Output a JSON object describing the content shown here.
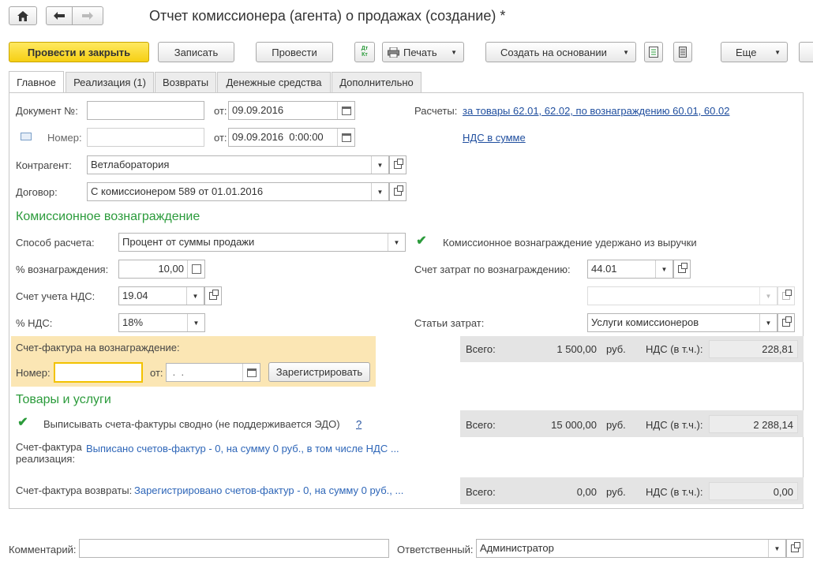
{
  "window": {
    "title": "Отчет комиссионера (агента) о продажах (создание) *"
  },
  "toolbar": {
    "post_and_close": "Провести и закрыть",
    "save": "Записать",
    "post": "Провести",
    "print": "Печать",
    "create_based_on": "Создать на основании",
    "more": "Еще",
    "dtkt_icon": "Дт Кт"
  },
  "tabs": [
    {
      "label": "Главное"
    },
    {
      "label": "Реализация (1)"
    },
    {
      "label": "Возвраты"
    },
    {
      "label": "Денежные средства"
    },
    {
      "label": "Дополнительно"
    }
  ],
  "main": {
    "doc_no_label": "Документ №:",
    "doc_no_value": "",
    "from_label": "от:",
    "doc_date": "09.09.2016",
    "number_label": "Номер:",
    "number_value": "",
    "number_datetime": "09.09.2016  0:00:00",
    "calc_label": "Расчеты:",
    "calc_link": "за товары 62.01, 62.02, по вознаграждению 60.01, 60.02",
    "vat_link": "НДС в сумме",
    "contractor_label": "Контрагент:",
    "contractor_value": "Ветлаборатория",
    "contract_label": "Договор:",
    "contract_value": "С комиссионером 589 от 01.01.2016"
  },
  "commission": {
    "section_title": "Комиссионное вознаграждение",
    "method_label": "Способ расчета:",
    "method_value": "Процент от суммы продажи",
    "withheld_label": "Комиссионное вознаграждение удержано из выручки",
    "withheld_checked": true,
    "percent_label": "% вознаграждения:",
    "percent_value": "10,00",
    "cost_account_label": "Счет затрат по вознаграждению:",
    "cost_account_value": "44.01",
    "vat_account_label": "Счет учета НДС:",
    "vat_account_value": "19.04",
    "extra_value": "",
    "vat_rate_label": "% НДС:",
    "vat_rate_value": "18%",
    "cost_items_label": "Статьи затрат:",
    "cost_items_value": "Услуги комиссионеров",
    "invoice_title": "Счет-фактура на вознаграждение:",
    "invoice_number_label": "Номер:",
    "invoice_number_value": "",
    "invoice_from_label": "от:",
    "invoice_date_value": " .  .",
    "register_button": "Зарегистрировать",
    "total_label": "Всего:",
    "total_value": "1 500,00",
    "currency": "руб.",
    "vat_incl_label": "НДС (в т.ч.):",
    "vat_value": "228,81"
  },
  "goods": {
    "section_title": "Товары и услуги",
    "summary_invoices_label": "Выписывать счета-фактуры сводно (не поддерживается ЭДО)",
    "summary_invoices_checked": true,
    "help": "?",
    "total_label": "Всего:",
    "total_value": "15 000,00",
    "currency": "руб.",
    "vat_incl_label": "НДС (в т.ч.):",
    "vat_value": "2 288,14",
    "invoice_sales_label_1": "Счет-фактура",
    "invoice_sales_label_2": "реализация:",
    "invoice_sales_link": "Выписано счетов-фактур - 0, на сумму 0 руб., в том числе НДС ...",
    "invoice_returns_label": "Счет-фактура возвраты:",
    "invoice_returns_link": "Зарегистрировано счетов-фактур - 0, на сумму 0 руб., ...",
    "returns_total_label": "Всего:",
    "returns_total_value": "0,00",
    "returns_currency": "руб.",
    "returns_vat_label": "НДС (в т.ч.):",
    "returns_vat_value": "0,00"
  },
  "footer": {
    "comment_label": "Комментарий:",
    "comment_value": "",
    "responsible_label": "Ответственный:",
    "responsible_value": "Администратор"
  },
  "colors": {
    "accent_green": "#2b9b3b",
    "link_blue": "#1f4e9e",
    "primary_yellow": "#f6cf14",
    "invoice_highlight": "#fbe6b4"
  }
}
